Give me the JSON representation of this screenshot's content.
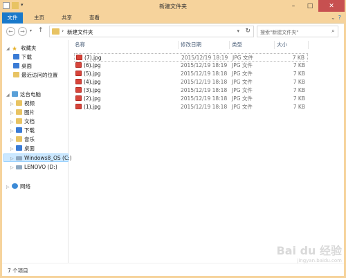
{
  "window": {
    "title": "新建文件夹"
  },
  "ribbon": {
    "tabs": [
      "文件",
      "主页",
      "共享",
      "查看"
    ]
  },
  "address": {
    "path": "新建文件夹",
    "search_placeholder": "搜索\"新建文件夹\""
  },
  "nav": {
    "favorites": {
      "label": "收藏夹",
      "items": [
        "下载",
        "桌面",
        "最近访问的位置"
      ]
    },
    "computer": {
      "label": "这台电脑",
      "items": [
        "视频",
        "图片",
        "文档",
        "下载",
        "音乐",
        "桌面",
        "Windows8_OS (C:)",
        "LENOVO (D:)"
      ]
    },
    "network": {
      "label": "网络"
    }
  },
  "columns": {
    "name": "名称",
    "modified": "修改日期",
    "type": "类型",
    "size": "大小"
  },
  "files": [
    {
      "name": "(7).jpg",
      "modified": "2015/12/19 18:19",
      "type": "JPG 文件",
      "size": "7 KB"
    },
    {
      "name": "(6).jpg",
      "modified": "2015/12/19 18:19",
      "type": "JPG 文件",
      "size": "7 KB"
    },
    {
      "name": "(5).jpg",
      "modified": "2015/12/19 18:18",
      "type": "JPG 文件",
      "size": "7 KB"
    },
    {
      "name": "(4).jpg",
      "modified": "2015/12/19 18:18",
      "type": "JPG 文件",
      "size": "7 KB"
    },
    {
      "name": "(3).jpg",
      "modified": "2015/12/19 18:18",
      "type": "JPG 文件",
      "size": "7 KB"
    },
    {
      "name": "(2).jpg",
      "modified": "2015/12/19 18:18",
      "type": "JPG 文件",
      "size": "7 KB"
    },
    {
      "name": "(1).jpg",
      "modified": "2015/12/19 18:18",
      "type": "JPG 文件",
      "size": "7 KB"
    }
  ],
  "status": {
    "count": "7 个项目"
  },
  "watermark": {
    "brand": "Bai du 经验",
    "url": "jingyan.baidu.com"
  },
  "colors": {
    "titlebar": "#f6d39c",
    "file_tab": "#1979ca",
    "selection": "#cce8ff"
  }
}
